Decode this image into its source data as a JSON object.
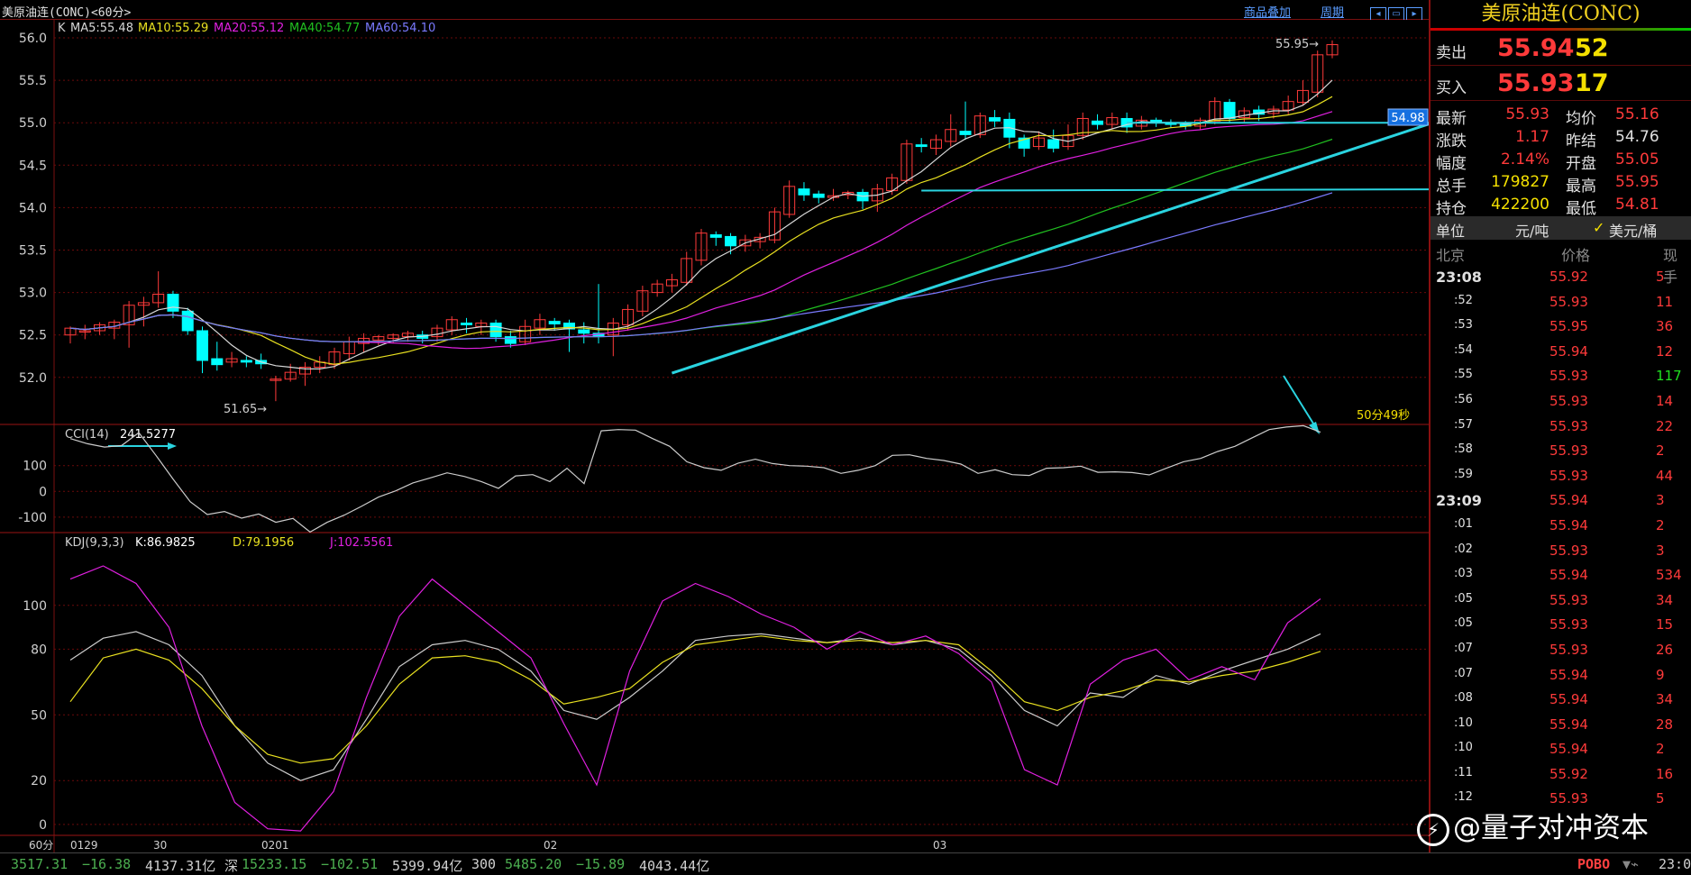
{
  "window": {
    "title": "美原油连(CONC)<60分>",
    "links": [
      "商品叠加",
      "周期"
    ]
  },
  "chart_data": [
    {
      "type": "candlestick",
      "panel": "K",
      "ylim": [
        51.5,
        56.2
      ],
      "yticks": [
        "56.0",
        "55.5",
        "55.0",
        "54.5",
        "54.0",
        "53.5",
        "53.0",
        "52.5",
        "52.0"
      ],
      "indicators": [
        {
          "name": "MA5",
          "value": "55.48",
          "color": "#d8d8d8"
        },
        {
          "name": "MA10",
          "value": "55.29",
          "color": "#e8e020"
        },
        {
          "name": "MA20",
          "value": "55.12",
          "color": "#e020e0"
        },
        {
          "name": "MA40",
          "value": "54.77",
          "color": "#20c020"
        },
        {
          "name": "MA60",
          "value": "54.10",
          "color": "#7a7aff"
        }
      ],
      "x_labels": [
        "0129",
        "30",
        "0201",
        "02",
        "03"
      ],
      "annotations": {
        "high": "55.95",
        "low": "51.65",
        "current_price_tag": "54.98",
        "countdown": "50分49秒"
      },
      "candles": [
        [
          52.5,
          52.58,
          52.4,
          52.6
        ],
        [
          52.55,
          52.55,
          52.45,
          52.62
        ],
        [
          52.55,
          52.62,
          52.5,
          52.65
        ],
        [
          52.58,
          52.65,
          52.45,
          52.68
        ],
        [
          52.62,
          52.85,
          52.35,
          52.9
        ],
        [
          52.85,
          52.88,
          52.6,
          52.95
        ],
        [
          52.88,
          52.98,
          52.82,
          53.25
        ],
        [
          52.98,
          52.78,
          52.7,
          53.02
        ],
        [
          52.78,
          52.55,
          52.5,
          52.82
        ],
        [
          52.55,
          52.2,
          52.05,
          52.6
        ],
        [
          52.22,
          52.15,
          52.08,
          52.42
        ],
        [
          52.18,
          52.22,
          52.12,
          52.3
        ],
        [
          52.2,
          52.18,
          52.12,
          52.25
        ],
        [
          52.2,
          52.16,
          52.1,
          52.28
        ],
        [
          51.98,
          51.98,
          51.72,
          52.02
        ],
        [
          51.98,
          52.06,
          51.95,
          52.16
        ],
        [
          52.04,
          52.12,
          51.9,
          52.18
        ],
        [
          52.12,
          52.18,
          52.05,
          52.25
        ],
        [
          52.15,
          52.3,
          52.1,
          52.35
        ],
        [
          52.28,
          52.42,
          52.2,
          52.48
        ],
        [
          52.4,
          52.46,
          52.3,
          52.52
        ],
        [
          52.44,
          52.48,
          52.38,
          52.5
        ],
        [
          52.46,
          52.5,
          52.4,
          52.52
        ],
        [
          52.48,
          52.52,
          52.42,
          52.55
        ],
        [
          52.5,
          52.46,
          52.4,
          52.55
        ],
        [
          52.48,
          52.58,
          52.42,
          52.62
        ],
        [
          52.56,
          52.68,
          52.5,
          52.72
        ],
        [
          52.64,
          52.62,
          52.52,
          52.7
        ],
        [
          52.6,
          52.64,
          52.5,
          52.68
        ],
        [
          52.64,
          52.48,
          52.42,
          52.68
        ],
        [
          52.48,
          52.4,
          52.35,
          52.55
        ],
        [
          52.42,
          52.6,
          52.38,
          52.68
        ],
        [
          52.58,
          52.68,
          52.5,
          52.75
        ],
        [
          52.66,
          52.63,
          52.55,
          52.7
        ],
        [
          52.64,
          52.57,
          52.3,
          52.68
        ],
        [
          52.56,
          52.52,
          52.4,
          52.65
        ],
        [
          52.52,
          52.48,
          52.4,
          53.1
        ],
        [
          52.5,
          52.64,
          52.25,
          52.7
        ],
        [
          52.62,
          52.8,
          52.55,
          52.86
        ],
        [
          52.78,
          53.02,
          52.72,
          53.08
        ],
        [
          53.0,
          53.1,
          52.95,
          53.15
        ],
        [
          53.08,
          53.15,
          53.0,
          53.22
        ],
        [
          53.12,
          53.4,
          53.08,
          53.48
        ],
        [
          53.38,
          53.7,
          53.32,
          53.75
        ],
        [
          53.68,
          53.65,
          53.55,
          53.72
        ],
        [
          53.66,
          53.55,
          53.45,
          53.7
        ],
        [
          53.55,
          53.62,
          53.48,
          53.68
        ],
        [
          53.6,
          53.65,
          53.52,
          53.7
        ],
        [
          53.62,
          53.95,
          53.58,
          54.0
        ],
        [
          53.92,
          54.25,
          53.88,
          54.32
        ],
        [
          54.22,
          54.15,
          54.08,
          54.3
        ],
        [
          54.16,
          54.12,
          54.05,
          54.2
        ],
        [
          54.12,
          54.14,
          54.08,
          54.22
        ],
        [
          54.15,
          54.18,
          54.1,
          54.2
        ],
        [
          54.18,
          54.08,
          53.98,
          54.22
        ],
        [
          54.08,
          54.22,
          53.95,
          54.28
        ],
        [
          54.2,
          54.35,
          54.15,
          54.4
        ],
        [
          54.32,
          54.75,
          54.28,
          54.8
        ],
        [
          54.74,
          54.72,
          54.65,
          54.82
        ],
        [
          54.7,
          54.8,
          54.62,
          54.86
        ],
        [
          54.78,
          54.92,
          54.72,
          55.1
        ],
        [
          54.9,
          54.86,
          54.8,
          55.25
        ],
        [
          54.86,
          55.08,
          54.82,
          55.12
        ],
        [
          55.06,
          55.02,
          54.95,
          55.15
        ],
        [
          55.04,
          54.83,
          54.7,
          55.12
        ],
        [
          54.82,
          54.7,
          54.6,
          54.86
        ],
        [
          54.72,
          54.82,
          54.68,
          54.9
        ],
        [
          54.8,
          54.7,
          54.65,
          54.92
        ],
        [
          54.72,
          54.85,
          54.68,
          54.98
        ],
        [
          54.85,
          55.05,
          54.8,
          55.12
        ],
        [
          55.02,
          54.98,
          54.92,
          55.1
        ],
        [
          54.98,
          55.06,
          54.92,
          55.12
        ],
        [
          55.05,
          54.95,
          54.88,
          55.12
        ],
        [
          54.96,
          55.03,
          54.92,
          55.08
        ],
        [
          55.03,
          55.0,
          54.95,
          55.06
        ],
        [
          55.0,
          54.98,
          54.94,
          55.04
        ],
        [
          54.98,
          54.96,
          54.92,
          55.02
        ],
        [
          54.96,
          55.03,
          54.92,
          55.06
        ],
        [
          55.02,
          55.25,
          54.98,
          55.3
        ],
        [
          55.24,
          55.05,
          55.0,
          55.28
        ],
        [
          55.06,
          55.14,
          55.0,
          55.18
        ],
        [
          55.15,
          55.1,
          55.02,
          55.2
        ],
        [
          55.11,
          55.16,
          55.05,
          55.2
        ],
        [
          55.15,
          55.25,
          55.1,
          55.32
        ],
        [
          55.24,
          55.38,
          55.2,
          55.5
        ],
        [
          55.36,
          55.8,
          55.3,
          55.85
        ],
        [
          55.8,
          55.92,
          55.76,
          55.97
        ]
      ],
      "trendlines": [
        {
          "from": [
            41,
            52.05
          ],
          "to": [
            102,
            55.52
          ]
        },
        {
          "from": [
            72,
            55.0
          ],
          "to": [
            104,
            55.0
          ]
        },
        {
          "from": [
            58,
            54.2
          ],
          "to": [
            104,
            54.22
          ]
        }
      ]
    },
    {
      "type": "line",
      "panel": "CCI",
      "label": "CCI(14)",
      "value": "241.5277",
      "yticks": [
        "100",
        "0",
        "-100"
      ],
      "ylim": [
        -160,
        260
      ],
      "series": [
        {
          "name": "CCI",
          "color": "#cccccc",
          "values": [
            205,
            185,
            172,
            178,
            228,
            140,
            48,
            -40,
            -90,
            -78,
            -104,
            -88,
            -120,
            -105,
            -158,
            -120,
            -92,
            -58,
            -22,
            2,
            33,
            52,
            72,
            58,
            38,
            12,
            60,
            65,
            38,
            90,
            30,
            235,
            240,
            238,
            205,
            175,
            115,
            92,
            82,
            110,
            125,
            108,
            100,
            98,
            92,
            70,
            82,
            100,
            140,
            142,
            128,
            120,
            106,
            70,
            84,
            65,
            62,
            90,
            92,
            98,
            74,
            76,
            73,
            64,
            90,
            115,
            128,
            155,
            175,
            208,
            240,
            250,
            255,
            230
          ]
        }
      ]
    },
    {
      "type": "line",
      "panel": "KDJ",
      "label": "KDJ(9,3,3)",
      "values": {
        "K": "86.9825",
        "D": "79.1956",
        "J": "102.5561"
      },
      "yticks": [
        "100",
        "80",
        "50",
        "20",
        "0"
      ],
      "ylim": [
        -5,
        125
      ],
      "series": [
        {
          "name": "K",
          "color": "#cccccc",
          "values": [
            75,
            85,
            88,
            82,
            68,
            45,
            28,
            20,
            25,
            48,
            72,
            82,
            84,
            80,
            70,
            52,
            48,
            58,
            70,
            84,
            86,
            87,
            85,
            83,
            85,
            82,
            84,
            80,
            68,
            52,
            45,
            60,
            58,
            68,
            64,
            70,
            75,
            80,
            87
          ]
        },
        {
          "name": "D",
          "color": "#e8e020",
          "values": [
            56,
            76,
            80,
            75,
            62,
            45,
            32,
            28,
            30,
            45,
            64,
            76,
            77,
            74,
            66,
            55,
            58,
            62,
            74,
            82,
            84,
            86,
            84,
            83,
            84,
            83,
            84,
            82,
            70,
            56,
            52,
            58,
            61,
            66,
            65,
            68,
            70,
            74,
            79
          ]
        },
        {
          "name": "J",
          "color": "#e020e0",
          "values": [
            112,
            118,
            110,
            90,
            45,
            10,
            -2,
            -3,
            15,
            58,
            95,
            112,
            100,
            88,
            76,
            46,
            18,
            70,
            102,
            110,
            104,
            96,
            90,
            80,
            88,
            82,
            86,
            78,
            65,
            25,
            18,
            64,
            75,
            80,
            66,
            72,
            66,
            92,
            103
          ]
        }
      ]
    }
  ],
  "sidebar": {
    "title": "美原油连(CONC)",
    "sell": {
      "label": "卖出",
      "price": "55.94",
      "vol": "52"
    },
    "buy": {
      "label": "买入",
      "price": "55.93",
      "vol": "17"
    },
    "stats": [
      {
        "l1": "最新",
        "v1": "55.93",
        "l2": "均价",
        "v2": "55.16"
      },
      {
        "l1": "涨跌",
        "v1": "1.17",
        "l2": "昨结",
        "v2": "54.76"
      },
      {
        "l1": "幅度",
        "v1": "2.14%",
        "l2": "开盘",
        "v2": "55.05"
      },
      {
        "l1": "总手",
        "v1": "179827",
        "l2": "最高",
        "v2": "55.95"
      },
      {
        "l1": "持仓",
        "v1": "422200",
        "l2": "最低",
        "v2": "54.81"
      }
    ],
    "unit": {
      "label": "单位",
      "value": "元/吨",
      "alt": "美元/桶"
    },
    "headers": [
      "北京",
      "价格",
      "现手"
    ],
    "trades": [
      {
        "t": "23:08",
        "p": "55.92",
        "v": "5"
      },
      {
        "t": ":52",
        "p": "55.93",
        "v": "11"
      },
      {
        "t": ":53",
        "p": "55.95",
        "v": "36"
      },
      {
        "t": ":54",
        "p": "55.94",
        "v": "12"
      },
      {
        "t": ":55",
        "p": "55.93",
        "v": "117"
      },
      {
        "t": ":56",
        "p": "55.93",
        "v": "14"
      },
      {
        "t": ":57",
        "p": "55.93",
        "v": "22"
      },
      {
        "t": ":58",
        "p": "55.93",
        "v": "2"
      },
      {
        "t": ":59",
        "p": "55.93",
        "v": "44"
      },
      {
        "t": "23:09",
        "p": "55.94",
        "v": "3"
      },
      {
        "t": ":01",
        "p": "55.94",
        "v": "2"
      },
      {
        "t": ":02",
        "p": "55.93",
        "v": "3"
      },
      {
        "t": ":03",
        "p": "55.94",
        "v": "534"
      },
      {
        "t": ":05",
        "p": "55.93",
        "v": "34"
      },
      {
        "t": ":05",
        "p": "55.93",
        "v": "15"
      },
      {
        "t": ":07",
        "p": "55.93",
        "v": "26"
      },
      {
        "t": ":07",
        "p": "55.94",
        "v": "9"
      },
      {
        "t": ":08",
        "p": "55.94",
        "v": "34"
      },
      {
        "t": ":10",
        "p": "55.94",
        "v": "28"
      },
      {
        "t": ":10",
        "p": "55.94",
        "v": "2"
      },
      {
        "t": ":11",
        "p": "55.92",
        "v": "16"
      },
      {
        "t": ":12",
        "p": "55.93",
        "v": "5"
      }
    ]
  },
  "footer": {
    "period": "60分",
    "watermark": "@量子对冲资本",
    "brand": "POBO",
    "time": "23:0",
    "items": [
      {
        "v": "3517.31",
        "c": "#4caf50"
      },
      {
        "v": "−16.38",
        "c": "#4caf50"
      },
      {
        "v": "4137.31亿",
        "c": "#d0d0d0"
      },
      {
        "v": "深",
        "c": "#d0d0d0"
      },
      {
        "v": "15233.15",
        "c": "#4caf50"
      },
      {
        "v": "−102.51",
        "c": "#4caf50"
      },
      {
        "v": "5399.94亿",
        "c": "#d0d0d0"
      },
      {
        "v": "300",
        "c": "#d0d0d0"
      },
      {
        "v": "5485.20",
        "c": "#4caf50"
      },
      {
        "v": "−15.89",
        "c": "#4caf50"
      },
      {
        "v": "4043.44亿",
        "c": "#d0d0d0"
      }
    ]
  },
  "colors": {
    "up": "#ff3a3a",
    "down": "#00ffff",
    "grid": "#6a0a0a",
    "trend": "#2ad4e0"
  }
}
